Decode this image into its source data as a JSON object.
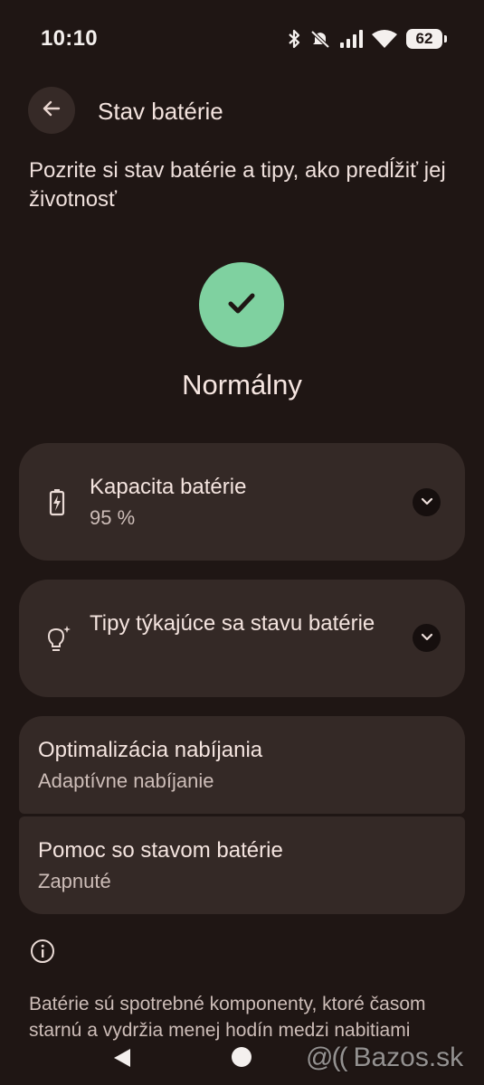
{
  "status_bar": {
    "time": "10:10",
    "battery_level": "62",
    "icons": [
      "bluetooth-icon",
      "mute-icon",
      "signal-icon",
      "wifi-icon",
      "battery-icon"
    ]
  },
  "header": {
    "title": "Stav batérie"
  },
  "intro": "Pozrite si stav batérie a tipy, ako predĺžiť jej životnosť",
  "status": {
    "label": "Normálny",
    "color": "#7fd1a0"
  },
  "cards": {
    "capacity": {
      "title": "Kapacita batérie",
      "value": "95 %"
    },
    "tips": {
      "title": "Tipy týkajúce sa stavu batérie"
    }
  },
  "settings": {
    "charging_optimization": {
      "title": "Optimalizácia nabíjania",
      "value": "Adaptívne nabíjanie"
    },
    "health_assistance": {
      "title": "Pomoc so stavom batérie",
      "value": "Zapnuté"
    }
  },
  "footer": {
    "text": "Batérie sú spotrebné komponenty, ktoré časom starnú a vydržia menej hodín medzi nabitiami"
  },
  "watermark": {
    "mark": "@((",
    "text": "Bazos.sk"
  },
  "colors": {
    "background": "#1f1614",
    "card": "#342926",
    "accent": "#7fd1a0"
  }
}
